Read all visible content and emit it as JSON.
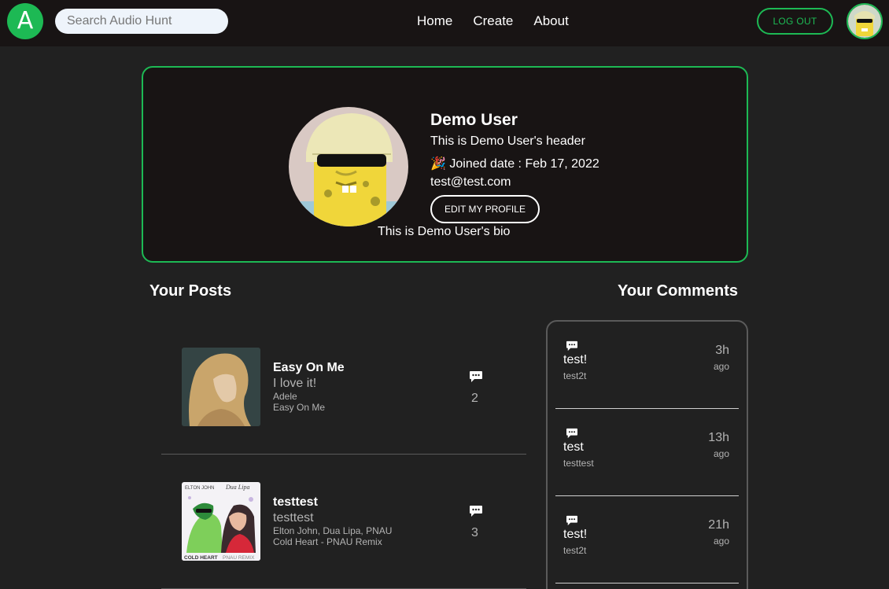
{
  "navbar": {
    "logo_letter": "A",
    "search_placeholder": "Search Audio Hunt",
    "links": [
      "Home",
      "Create",
      "About"
    ],
    "logout_label": "LOG OUT"
  },
  "profile": {
    "name": "Demo User",
    "header": "This is Demo User's header",
    "joined_emoji": "🎉",
    "joined": "Joined date : Feb 17, 2022",
    "email": "test@test.com",
    "edit_label": "EDIT MY PROFILE",
    "bio": "This is Demo User's bio"
  },
  "sections": {
    "posts_title": "Your Posts",
    "comments_title": "Your Comments"
  },
  "posts": [
    {
      "title": "Easy On Me",
      "caption": "I love it!",
      "artist": "Adele",
      "song": "Easy On Me",
      "comment_count": "2"
    },
    {
      "title": "testtest",
      "caption": "testtest",
      "artist": "Elton John, Dua Lipa, PNAU",
      "song": "Cold Heart - PNAU Remix",
      "comment_count": "3",
      "cover_text_left": "ELTON JOHN",
      "cover_text_right": "Dua Lipa",
      "cover_bottom_left": "COLD HEART",
      "cover_bottom_right": "PNAU REMIX"
    }
  ],
  "comments": [
    {
      "text": "test!",
      "user": "test2t",
      "time": "3h",
      "ago": "ago"
    },
    {
      "text": "test",
      "user": "testtest",
      "time": "13h",
      "ago": "ago"
    },
    {
      "text": "test!",
      "user": "test2t",
      "time": "21h",
      "ago": "ago"
    }
  ],
  "colors": {
    "accent": "#1db954",
    "background": "#212121",
    "card": "#181414"
  }
}
